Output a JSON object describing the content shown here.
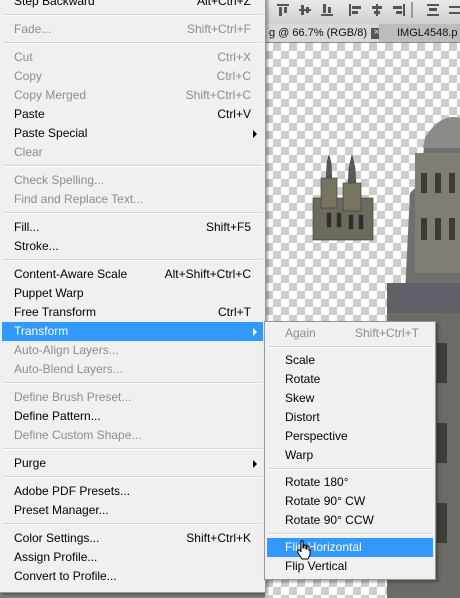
{
  "document": {
    "tabs": [
      {
        "label": "g @ 66.7% (RGB/8)",
        "close": "×",
        "active": true
      },
      {
        "label": "IMGL4548.p",
        "active": false
      }
    ]
  },
  "edit_menu": {
    "items": [
      {
        "label": "Step Backward",
        "shortcut": "Alt+Ctrl+Z",
        "disabled": false
      },
      {
        "sep": true
      },
      {
        "label": "Fade...",
        "shortcut": "Shift+Ctrl+F",
        "disabled": true
      },
      {
        "sep": true
      },
      {
        "label": "Cut",
        "shortcut": "Ctrl+X",
        "disabled": true
      },
      {
        "label": "Copy",
        "shortcut": "Ctrl+C",
        "disabled": true
      },
      {
        "label": "Copy Merged",
        "shortcut": "Shift+Ctrl+C",
        "disabled": true
      },
      {
        "label": "Paste",
        "shortcut": "Ctrl+V",
        "disabled": false
      },
      {
        "label": "Paste Special",
        "shortcut": "",
        "submenu": true,
        "disabled": false
      },
      {
        "label": "Clear",
        "shortcut": "",
        "disabled": true
      },
      {
        "sep": true
      },
      {
        "label": "Check Spelling...",
        "shortcut": "",
        "disabled": true
      },
      {
        "label": "Find and Replace Text...",
        "shortcut": "",
        "disabled": true
      },
      {
        "sep": true
      },
      {
        "label": "Fill...",
        "shortcut": "Shift+F5",
        "disabled": false
      },
      {
        "label": "Stroke...",
        "shortcut": "",
        "disabled": false
      },
      {
        "sep": true
      },
      {
        "label": "Content-Aware Scale",
        "shortcut": "Alt+Shift+Ctrl+C",
        "disabled": false
      },
      {
        "label": "Puppet Warp",
        "shortcut": "",
        "disabled": false
      },
      {
        "label": "Free Transform",
        "shortcut": "Ctrl+T",
        "disabled": false
      },
      {
        "label": "Transform",
        "shortcut": "",
        "submenu": true,
        "highlighted": true,
        "disabled": false
      },
      {
        "label": "Auto-Align Layers...",
        "shortcut": "",
        "disabled": true
      },
      {
        "label": "Auto-Blend Layers...",
        "shortcut": "",
        "disabled": true
      },
      {
        "sep": true
      },
      {
        "label": "Define Brush Preset...",
        "shortcut": "",
        "disabled": true
      },
      {
        "label": "Define Pattern...",
        "shortcut": "",
        "disabled": false
      },
      {
        "label": "Define Custom Shape...",
        "shortcut": "",
        "disabled": true
      },
      {
        "sep": true
      },
      {
        "label": "Purge",
        "shortcut": "",
        "submenu": true,
        "disabled": false
      },
      {
        "sep": true
      },
      {
        "label": "Adobe PDF Presets...",
        "shortcut": "",
        "disabled": false
      },
      {
        "label": "Preset Manager...",
        "shortcut": "",
        "disabled": false
      },
      {
        "sep": true
      },
      {
        "label": "Color Settings...",
        "shortcut": "Shift+Ctrl+K",
        "disabled": false
      },
      {
        "label": "Assign Profile...",
        "shortcut": "",
        "disabled": false
      },
      {
        "label": "Convert to Profile...",
        "shortcut": "",
        "disabled": false
      }
    ]
  },
  "transform_menu": {
    "items": [
      {
        "label": "Again",
        "shortcut": "Shift+Ctrl+T",
        "disabled": true
      },
      {
        "sep": true
      },
      {
        "label": "Scale",
        "shortcut": "",
        "disabled": false
      },
      {
        "label": "Rotate",
        "shortcut": "",
        "disabled": false
      },
      {
        "label": "Skew",
        "shortcut": "",
        "disabled": false
      },
      {
        "label": "Distort",
        "shortcut": "",
        "disabled": false
      },
      {
        "label": "Perspective",
        "shortcut": "",
        "disabled": false
      },
      {
        "label": "Warp",
        "shortcut": "",
        "disabled": false
      },
      {
        "sep": true
      },
      {
        "label": "Rotate 180°",
        "shortcut": "",
        "disabled": false
      },
      {
        "label": "Rotate 90° CW",
        "shortcut": "",
        "disabled": false
      },
      {
        "label": "Rotate 90° CCW",
        "shortcut": "",
        "disabled": false
      },
      {
        "sep": true
      },
      {
        "label": "Flip Horizontal",
        "shortcut": "",
        "highlighted": true,
        "disabled": false
      },
      {
        "label": "Flip Vertical",
        "shortcut": "",
        "disabled": false
      }
    ]
  },
  "colors": {
    "menu_bg": "#f0f0f0",
    "highlight": "#3399ff",
    "disabled_text": "#8d8d8d"
  }
}
